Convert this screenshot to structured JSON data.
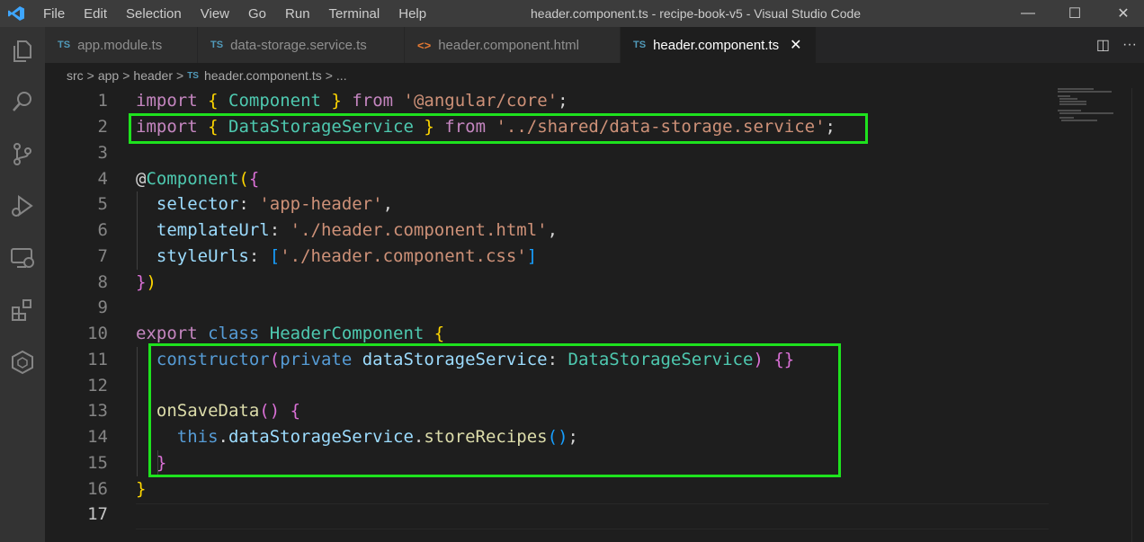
{
  "window": {
    "menu": [
      "File",
      "Edit",
      "Selection",
      "View",
      "Go",
      "Run",
      "Terminal",
      "Help"
    ],
    "title": "header.component.ts - recipe-book-v5 - Visual Studio Code",
    "minimize": "—",
    "maximize": "☐",
    "close": "✕"
  },
  "tabs": [
    {
      "icon": "TS",
      "label": "app.module.ts"
    },
    {
      "icon": "TS",
      "label": "data-storage.service.ts"
    },
    {
      "icon": "<>",
      "label": "header.component.html"
    },
    {
      "icon": "TS",
      "label": "header.component.ts",
      "close": "✕"
    }
  ],
  "tab_actions": {
    "split": "◫",
    "more": "···"
  },
  "breadcrumb": {
    "parts": [
      "src",
      "app",
      "header"
    ],
    "file_icon": "TS",
    "file": "header.component.ts",
    "symbol": "...",
    "sep": ">"
  },
  "editor": {
    "line_numbers": [
      "1",
      "2",
      "3",
      "4",
      "5",
      "6",
      "7",
      "8",
      "9",
      "10",
      "11",
      "12",
      "13",
      "14",
      "15",
      "16",
      "17"
    ],
    "current_line": "17",
    "code": {
      "l1": {
        "kw": "import",
        "b_open": "{",
        "name": "Component",
        "b_close": "}",
        "from": "from",
        "str": "'@angular/core'",
        "semi": ";"
      },
      "l2": {
        "kw": "import",
        "b_open": "{",
        "name": "DataStorageService",
        "b_close": "}",
        "from": "from",
        "str": "'../shared/data-storage.service'",
        "semi": ";"
      },
      "l4": {
        "at": "@",
        "dec": "Component",
        "p": "(",
        "b": "{"
      },
      "l5": {
        "key": "selector",
        "colon": ":",
        "str": "'app-header'",
        "comma": ","
      },
      "l6": {
        "key": "templateUrl",
        "colon": ":",
        "str": "'./header.component.html'",
        "comma": ","
      },
      "l7": {
        "key": "styleUrls",
        "colon": ":",
        "br_open": "[",
        "str": "'./header.component.css'",
        "br_close": "]"
      },
      "l8": {
        "b": "}",
        "p": ")"
      },
      "l10": {
        "export": "export",
        "class": "class",
        "name": "HeaderComponent",
        "b": "{"
      },
      "l11": {
        "ctor": "constructor",
        "p_open": "(",
        "private": "private",
        "param": "dataStorageService",
        "colon": ":",
        "type": "DataStorageService",
        "p_close": ")",
        "body": "{}"
      },
      "l13": {
        "fn": "onSaveData",
        "parens": "()",
        "b": "{"
      },
      "l14": {
        "this": "this",
        "dot1": ".",
        "prop": "dataStorageService",
        "dot2": ".",
        "method": "storeRecipes",
        "call": "()",
        "semi": ";"
      },
      "l15": {
        "b": "}"
      },
      "l16": {
        "b": "}"
      }
    }
  },
  "highlight_color": "#1ee21e"
}
